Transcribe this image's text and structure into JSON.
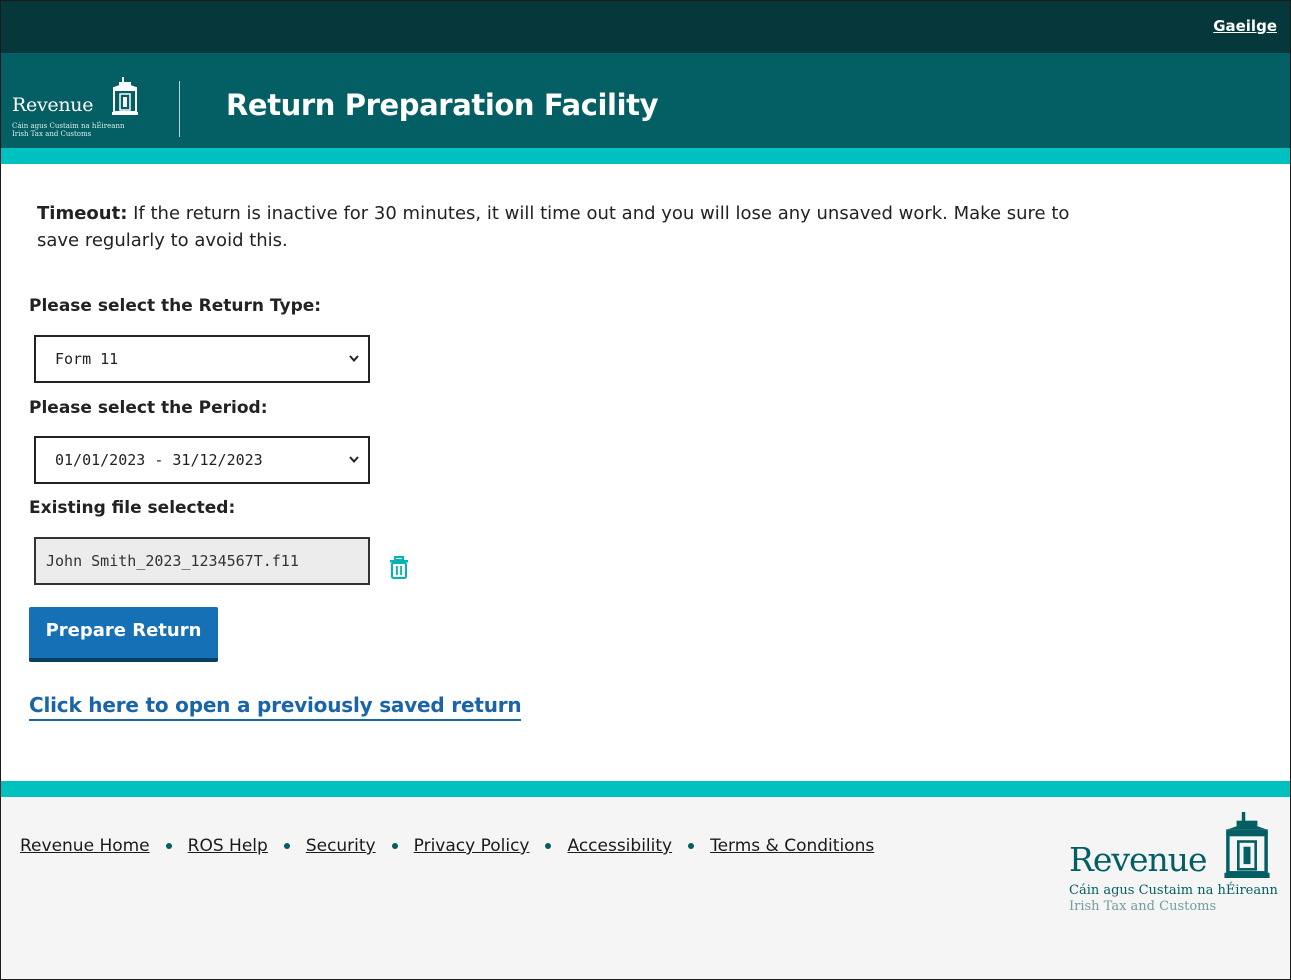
{
  "topbar": {
    "language_link": "Gaeilge"
  },
  "header": {
    "logo": {
      "wordmark": "Revenue",
      "line1": "Cáin agus Custaim na hÉireann",
      "line2": "Irish Tax and Customs"
    },
    "title": "Return Preparation Facility"
  },
  "main": {
    "timeout_label": "Timeout:",
    "timeout_text": " If the return is inactive for 30 minutes, it will time out and you will lose any unsaved work. Make sure to save regularly to avoid this.",
    "return_type_label": "Please select the Return Type:",
    "return_type_value": "Form 11",
    "period_label": "Please select the Period:",
    "period_value": "01/01/2023 - 31/12/2023",
    "existing_file_label": "Existing file selected:",
    "existing_file_value": "John Smith_2023_1234567T.f11",
    "prepare_button": "Prepare Return",
    "open_saved_link": "Click here to open a previously saved return"
  },
  "footer": {
    "links": [
      "Revenue Home",
      "ROS Help",
      "Security",
      "Privacy Policy",
      "Accessibility",
      "Terms & Conditions"
    ],
    "logo": {
      "wordmark": "Revenue",
      "line1": "Cáin agus Custaim na hÉireann",
      "line2": "Irish Tax and Customs"
    }
  },
  "colors": {
    "topbar": "#06373a",
    "header": "#035f63",
    "accent_stripe": "#00c1c0",
    "button": "#1670b6",
    "link": "#1a64a8"
  },
  "icons": [
    "chevron-down-icon",
    "trash-icon",
    "revenue-building-icon"
  ]
}
